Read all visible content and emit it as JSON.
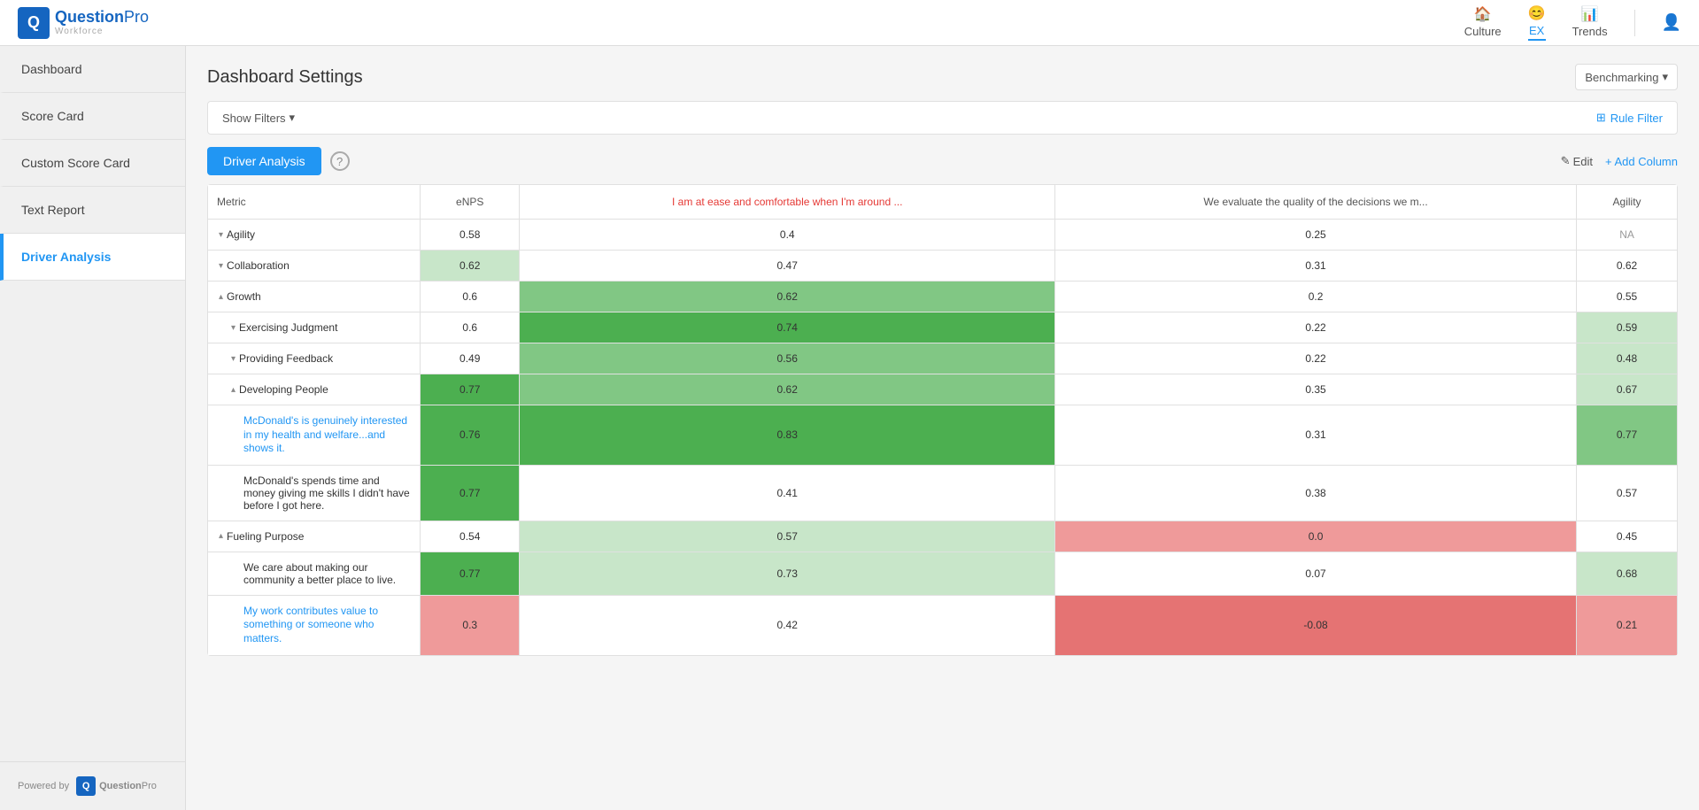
{
  "topNav": {
    "logoText": "QuestionPro",
    "logoSub": "Workforce",
    "links": [
      {
        "label": "Culture",
        "icon": "🏠",
        "active": false
      },
      {
        "label": "EX",
        "icon": "😊",
        "active": true
      },
      {
        "label": "Trends",
        "icon": "📊",
        "active": false
      }
    ]
  },
  "sidebar": {
    "items": [
      {
        "label": "Dashboard",
        "active": false
      },
      {
        "label": "Score Card",
        "active": false
      },
      {
        "label": "Custom Score Card",
        "active": false
      },
      {
        "label": "Text Report",
        "active": false
      },
      {
        "label": "Driver Analysis",
        "active": true
      }
    ],
    "poweredBy": "Powered by"
  },
  "pageTitle": "Dashboard Settings",
  "benchmarkingLabel": "Benchmarking",
  "filtersBar": {
    "showFiltersLabel": "Show Filters",
    "ruleFilterLabel": "Rule Filter"
  },
  "driverToolbar": {
    "activeTabLabel": "Driver Analysis",
    "helpTooltip": "?",
    "editLabel": "Edit",
    "addColumnLabel": "+ Add Column"
  },
  "table": {
    "headers": [
      "Metric",
      "eNPS",
      "I am at ease and comfortable when I'm around ...",
      "We evaluate the quality of the decisions we m...",
      "Agility"
    ],
    "rows": [
      {
        "metric": "Agility",
        "indent": 0,
        "chevron": "down",
        "isLink": false,
        "cells": [
          {
            "value": "0.58",
            "style": "plain"
          },
          {
            "value": "0.4",
            "style": "plain"
          },
          {
            "value": "0.25",
            "style": "plain"
          },
          {
            "value": "NA",
            "style": "na"
          }
        ]
      },
      {
        "metric": "Collaboration",
        "indent": 0,
        "chevron": "down",
        "isLink": false,
        "cells": [
          {
            "value": "0.62",
            "style": "green-light"
          },
          {
            "value": "0.47",
            "style": "plain"
          },
          {
            "value": "0.31",
            "style": "plain"
          },
          {
            "value": "0.62",
            "style": "plain"
          }
        ]
      },
      {
        "metric": "Growth",
        "indent": 0,
        "chevron": "up",
        "isLink": false,
        "cells": [
          {
            "value": "0.6",
            "style": "plain"
          },
          {
            "value": "0.62",
            "style": "green-medium"
          },
          {
            "value": "0.2",
            "style": "plain"
          },
          {
            "value": "0.55",
            "style": "plain"
          }
        ]
      },
      {
        "metric": "Exercising Judgment",
        "indent": 1,
        "chevron": "down",
        "isLink": false,
        "cells": [
          {
            "value": "0.6",
            "style": "plain"
          },
          {
            "value": "0.74",
            "style": "green-dark"
          },
          {
            "value": "0.22",
            "style": "plain"
          },
          {
            "value": "0.59",
            "style": "green-light"
          }
        ]
      },
      {
        "metric": "Providing Feedback",
        "indent": 1,
        "chevron": "down",
        "isLink": false,
        "cells": [
          {
            "value": "0.49",
            "style": "plain"
          },
          {
            "value": "0.56",
            "style": "green-medium"
          },
          {
            "value": "0.22",
            "style": "plain"
          },
          {
            "value": "0.48",
            "style": "green-light"
          }
        ]
      },
      {
        "metric": "Developing People",
        "indent": 1,
        "chevron": "up",
        "isLink": false,
        "cells": [
          {
            "value": "0.77",
            "style": "green-dark"
          },
          {
            "value": "0.62",
            "style": "green-medium"
          },
          {
            "value": "0.35",
            "style": "plain"
          },
          {
            "value": "0.67",
            "style": "green-light"
          }
        ]
      },
      {
        "metric": "McDonald's is genuinely interested in my health and welfare...and shows it.",
        "indent": 2,
        "chevron": null,
        "isLink": true,
        "cells": [
          {
            "value": "0.76",
            "style": "green-dark"
          },
          {
            "value": "0.83",
            "style": "green-dark"
          },
          {
            "value": "0.31",
            "style": "plain"
          },
          {
            "value": "0.77",
            "style": "green-medium"
          }
        ]
      },
      {
        "metric": "McDonald's spends time and money giving me skills I didn't have before I got here.",
        "indent": 2,
        "chevron": null,
        "isLink": false,
        "cells": [
          {
            "value": "0.77",
            "style": "green-dark"
          },
          {
            "value": "0.41",
            "style": "plain"
          },
          {
            "value": "0.38",
            "style": "plain"
          },
          {
            "value": "0.57",
            "style": "plain"
          }
        ]
      },
      {
        "metric": "Fueling Purpose",
        "indent": 0,
        "chevron": "up",
        "isLink": false,
        "cells": [
          {
            "value": "0.54",
            "style": "plain"
          },
          {
            "value": "0.57",
            "style": "green-light"
          },
          {
            "value": "0.0",
            "style": "red"
          },
          {
            "value": "0.45",
            "style": "plain"
          }
        ]
      },
      {
        "metric": "We care about making our community a better place to live.",
        "indent": 2,
        "chevron": null,
        "isLink": false,
        "cells": [
          {
            "value": "0.77",
            "style": "green-dark"
          },
          {
            "value": "0.73",
            "style": "green-light"
          },
          {
            "value": "0.07",
            "style": "plain"
          },
          {
            "value": "0.68",
            "style": "green-light"
          }
        ]
      },
      {
        "metric": "My work contributes value to something or someone who matters.",
        "indent": 2,
        "chevron": null,
        "isLink": true,
        "cells": [
          {
            "value": "0.3",
            "style": "red"
          },
          {
            "value": "0.42",
            "style": "plain"
          },
          {
            "value": "-0.08",
            "style": "red-dark"
          },
          {
            "value": "0.21",
            "style": "red"
          }
        ]
      }
    ]
  }
}
